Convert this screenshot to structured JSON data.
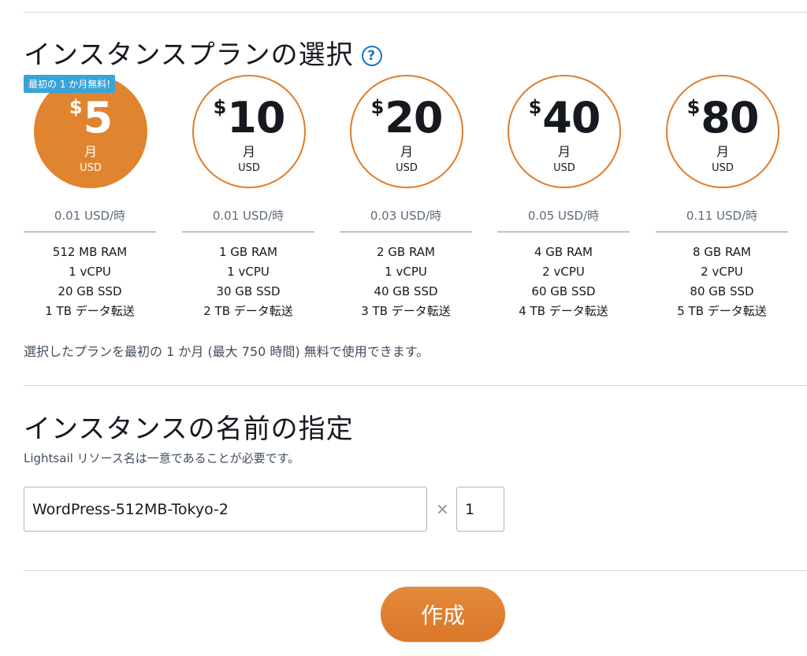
{
  "plan_section": {
    "title": "インスタンスプランの選択",
    "help_icon": "question-circle-icon",
    "free_badge": "最初の 1 か月無料!",
    "free_note": "選択したプランを最初の 1 か月 (最大 750 時間) 無料で使用できます。",
    "selected_plan_index": 0,
    "plans": [
      {
        "currency_symbol": "$",
        "price": "5",
        "unit": "月",
        "currency": "USD",
        "hourly": "0.01 USD/時",
        "specs": [
          "512 MB RAM",
          "1 vCPU",
          "20 GB SSD",
          "1 TB データ転送"
        ]
      },
      {
        "currency_symbol": "$",
        "price": "10",
        "unit": "月",
        "currency": "USD",
        "hourly": "0.01 USD/時",
        "specs": [
          "1 GB RAM",
          "1 vCPU",
          "30 GB SSD",
          "2 TB データ転送"
        ]
      },
      {
        "currency_symbol": "$",
        "price": "20",
        "unit": "月",
        "currency": "USD",
        "hourly": "0.03 USD/時",
        "specs": [
          "2 GB RAM",
          "1 vCPU",
          "40 GB SSD",
          "3 TB データ転送"
        ]
      },
      {
        "currency_symbol": "$",
        "price": "40",
        "unit": "月",
        "currency": "USD",
        "hourly": "0.05 USD/時",
        "specs": [
          "4 GB RAM",
          "2 vCPU",
          "60 GB SSD",
          "4 TB データ転送"
        ]
      },
      {
        "currency_symbol": "$",
        "price": "80",
        "unit": "月",
        "currency": "USD",
        "hourly": "0.11 USD/時",
        "specs": [
          "8 GB RAM",
          "2 vCPU",
          "80 GB SSD",
          "5 TB データ転送"
        ]
      }
    ]
  },
  "name_section": {
    "title": "インスタンスの名前の指定",
    "hint": "Lightsail リソース名は一意であることが必要です。",
    "instance_name": "WordPress-512MB-Tokyo-2",
    "multiplier": "×",
    "quantity": "1"
  },
  "actions": {
    "create_label": "作成"
  },
  "colors": {
    "accent_orange": "#e0842f",
    "badge_blue": "#3aa3d8",
    "help_blue": "#1a73c8"
  }
}
